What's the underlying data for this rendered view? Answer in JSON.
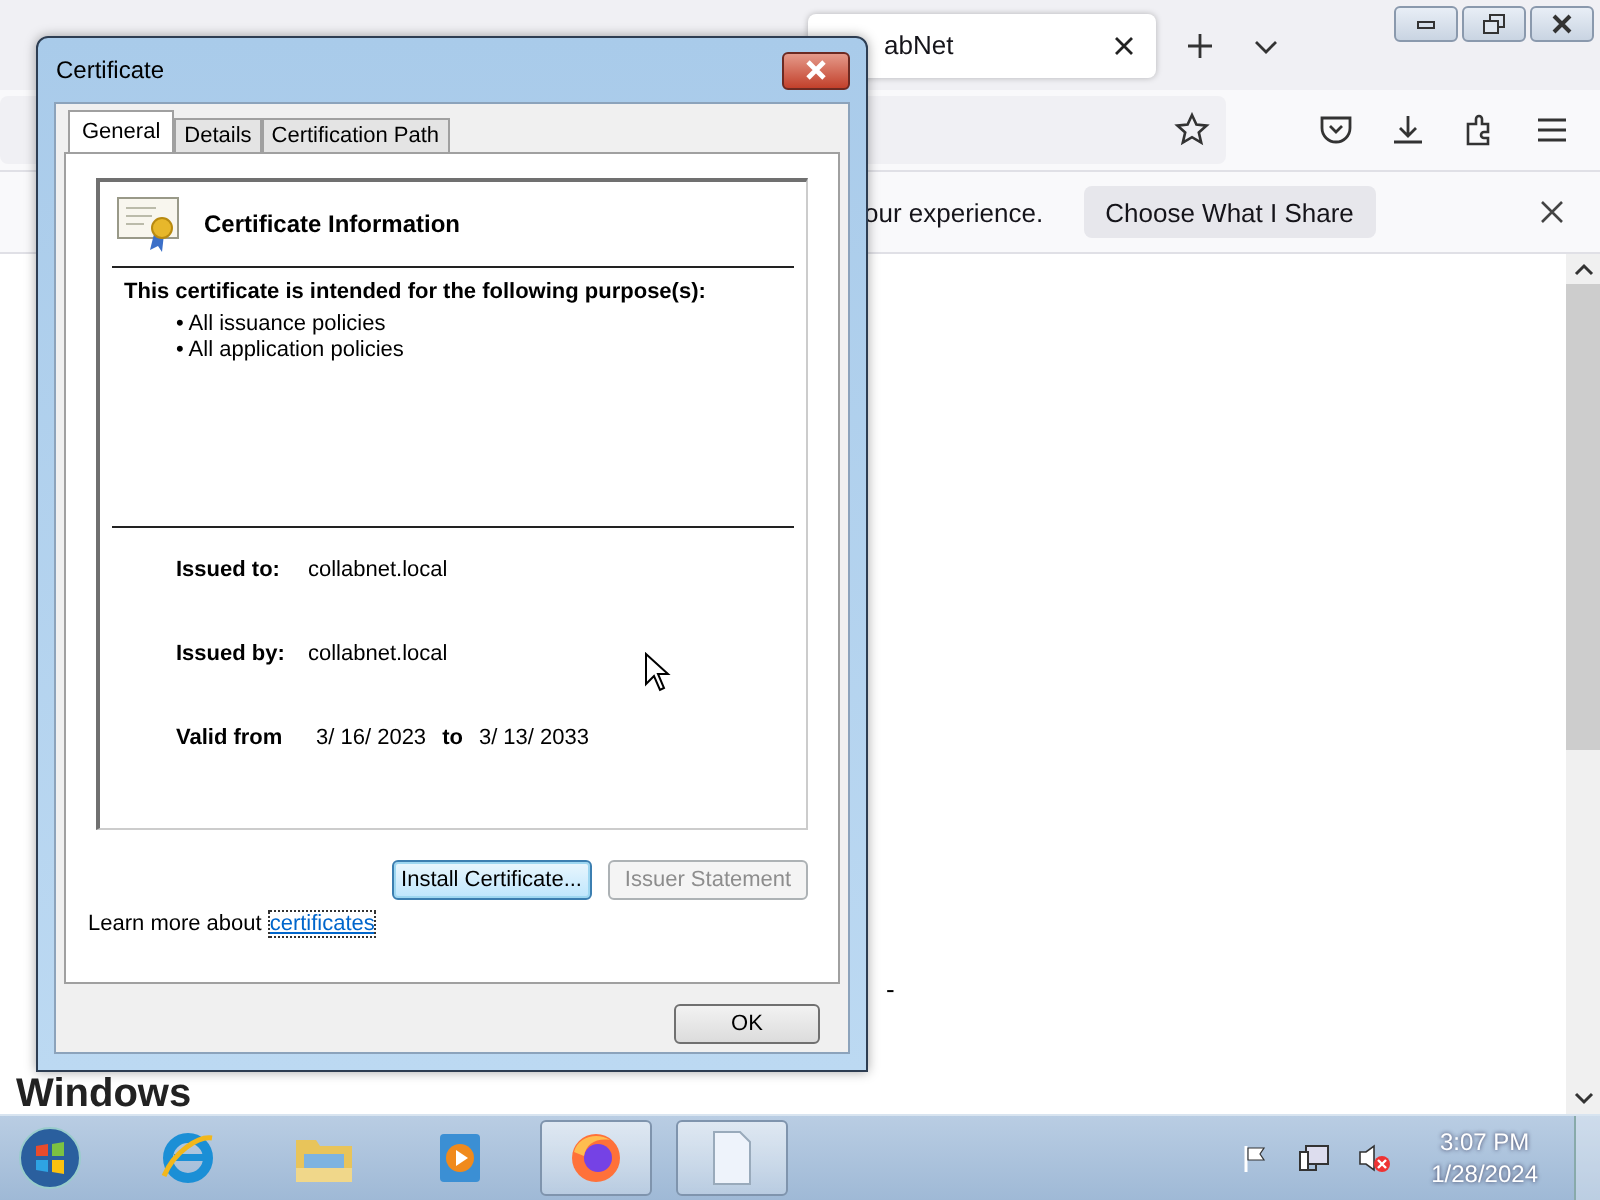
{
  "browser": {
    "tabs": [
      {
        "label": "abNet",
        "selected": true
      }
    ],
    "notification": {
      "text": "our experience.",
      "button": "Choose What I Share"
    }
  },
  "page": {
    "fragments": [
      {
        "text": "Windows",
        "kind": "h3"
      }
    ],
    "dash": "-"
  },
  "dialog": {
    "title": "Certificate",
    "tabs": [
      {
        "label": "General",
        "selected": true
      },
      {
        "label": "Details",
        "selected": false
      },
      {
        "label": "Certification Path",
        "selected": false
      }
    ],
    "heading": "Certificate Information",
    "purpose_title": "This certificate is intended for the following purpose(s):",
    "purposes": [
      "• All issuance policies",
      "• All application policies"
    ],
    "issued_to_label": "Issued to:",
    "issued_to": "collabnet.local",
    "issued_by_label": "Issued by:",
    "issued_by": "collabnet.local",
    "valid_from_label": "Valid from",
    "valid_from": "3/ 16/ 2023",
    "to_label": "to",
    "valid_to": "3/ 13/ 2033",
    "buttons": [
      {
        "label": "Install Certificate...",
        "disabled": false
      },
      {
        "label": "Issuer Statement",
        "disabled": true
      }
    ],
    "learn_more": "Learn more about",
    "learn_more_link": "certificates",
    "ok": "OK"
  },
  "taskbar": {
    "apps": [
      {
        "kind": "ie",
        "active": false
      },
      {
        "kind": "explorer",
        "active": false
      },
      {
        "kind": "media",
        "active": false
      },
      {
        "kind": "firefox",
        "active": true
      },
      {
        "kind": "document",
        "active": true
      }
    ],
    "time": "3:07 PM",
    "date": "1/28/2024"
  }
}
